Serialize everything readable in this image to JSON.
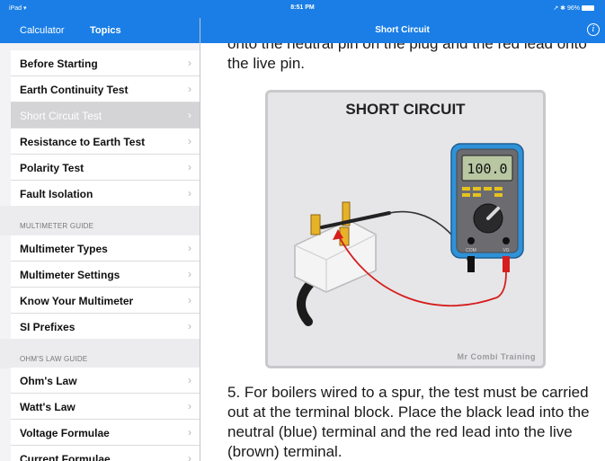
{
  "status_bar": {
    "carrier": "iPad ▾",
    "time": "8:51 PM",
    "right": "↗ ✱ 96%"
  },
  "nav": {
    "calculator": "Calculator",
    "topics": "Topics",
    "title": "Short Circuit",
    "info_icon": "info-icon"
  },
  "sidebar": {
    "items": [
      {
        "label": "Before Starting"
      },
      {
        "label": "Earth Continuity Test"
      },
      {
        "label": "Short Circuit Test",
        "selected": true
      },
      {
        "label": "Resistance to Earth Test"
      },
      {
        "label": "Polarity Test"
      },
      {
        "label": "Fault Isolation"
      }
    ],
    "sections": [
      {
        "header": "MULTIMETER GUIDE",
        "items": [
          {
            "label": "Multimeter Types"
          },
          {
            "label": "Multimeter Settings"
          },
          {
            "label": "Know Your Multimeter"
          },
          {
            "label": "SI Prefixes"
          }
        ]
      },
      {
        "header": "OHM'S LAW GUIDE",
        "items": [
          {
            "label": "Ohm's Law"
          },
          {
            "label": "Watt's Law"
          },
          {
            "label": "Voltage Formulae"
          },
          {
            "label": "Current Formulae"
          }
        ]
      }
    ]
  },
  "content": {
    "text_top": "onto the neutral pin on the plug and the red lead onto the live pin.",
    "figure": {
      "title": "SHORT CIRCUIT",
      "display": "100.0",
      "com_label": "COM",
      "v_label": "VΩ",
      "credit": "Mr Combi Training"
    },
    "text_bottom": "5. For boilers wired to a spur, the test must be carried out at the terminal block. Place the black lead into the neutral (blue) terminal and the red lead into the live (brown) terminal."
  },
  "colors": {
    "accent": "#1a7ee6",
    "meter_blue": "#2e92d8",
    "lead_red": "#d61e1e"
  }
}
